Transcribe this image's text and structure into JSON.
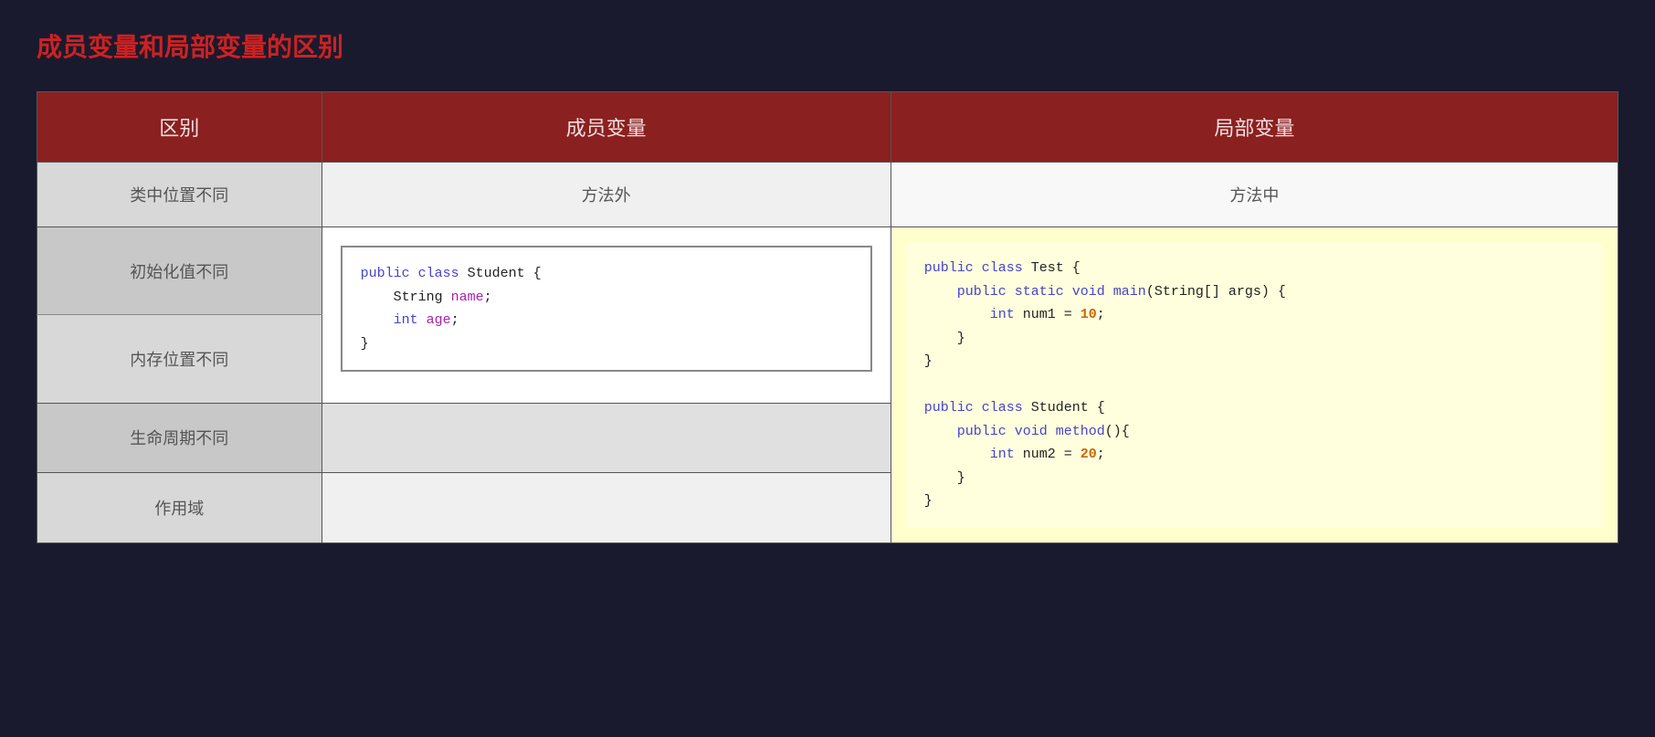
{
  "title": "成员变量和局部变量的区别",
  "table": {
    "headers": {
      "distinction": "区别",
      "member": "成员变量",
      "local": "局部变量"
    },
    "rows": [
      {
        "distinction": "类中位置不同",
        "member": "方法外",
        "local": "方法中"
      },
      {
        "distinction": "初始化值不同",
        "member_code": true,
        "local_code": true
      },
      {
        "distinction": "内存位置不同",
        "member": "",
        "local": ""
      },
      {
        "distinction": "生命周期不同",
        "member": "",
        "local": ""
      },
      {
        "distinction": "作用域",
        "member": "",
        "local": ""
      }
    ],
    "member_code_lines": [
      {
        "text": "public class Student {",
        "keyword": "public class",
        "rest": " Student {"
      },
      {
        "text": "    String name;",
        "indent": "    ",
        "type": "String",
        "var": " name",
        "semi": ";"
      },
      {
        "text": "    int age;",
        "indent": "    ",
        "type": "int",
        "var": " age",
        "semi": ";"
      },
      {
        "text": "}"
      }
    ],
    "local_code_blocks": {
      "block1": [
        "public class Test {",
        "    public static void main(String[] args) {",
        "        int num1 = 10;",
        "    }",
        "}"
      ],
      "block2": [
        "",
        "public class Student {",
        "    public void method(){",
        "        int num2 = 20;",
        "    }",
        "}"
      ]
    }
  }
}
